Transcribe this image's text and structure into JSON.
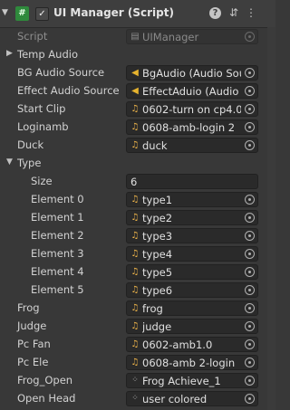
{
  "component": {
    "title": "UI Manager (Script)",
    "enabled": "✓",
    "script_icon": "#",
    "help": "?",
    "presets": "⇵",
    "menu": "⋮"
  },
  "fields": [
    {
      "label": "Script",
      "value": "UIManager",
      "icon": "script-icon",
      "dim": true
    },
    {
      "label": "Temp Audio",
      "foldout": "collapsed"
    },
    {
      "label": "BG Audio Source",
      "value": "BgAudio (Audio Sou",
      "icon": "audio-source-icon"
    },
    {
      "label": "Effect Audio Source",
      "value": "EffectAduio (Audio S",
      "icon": "audio-source-icon"
    },
    {
      "label": "Start Clip",
      "value": "0602-turn on cp4.0",
      "icon": "audio-clip-icon"
    },
    {
      "label": "Loginamb",
      "value": "0608-amb-login 2",
      "icon": "audio-clip-icon"
    },
    {
      "label": "Duck",
      "value": "duck",
      "icon": "audio-clip-icon"
    },
    {
      "label": "Type",
      "foldout": "expanded"
    },
    {
      "label": "Size",
      "number": "6"
    },
    {
      "label": "Element 0",
      "value": "type1",
      "icon": "audio-clip-icon"
    },
    {
      "label": "Element 1",
      "value": "type2",
      "icon": "audio-clip-icon"
    },
    {
      "label": "Element 2",
      "value": "type3",
      "icon": "audio-clip-icon"
    },
    {
      "label": "Element 3",
      "value": "type4",
      "icon": "audio-clip-icon"
    },
    {
      "label": "Element 4",
      "value": "type5",
      "icon": "audio-clip-icon"
    },
    {
      "label": "Element 5",
      "value": "type6",
      "icon": "audio-clip-icon"
    },
    {
      "label": "Frog",
      "value": "frog",
      "icon": "audio-clip-icon"
    },
    {
      "label": "Judge",
      "value": "judge",
      "icon": "audio-clip-icon"
    },
    {
      "label": "Pc Fan",
      "value": "0602-amb1.0",
      "icon": "audio-clip-icon"
    },
    {
      "label": "Pc Ele",
      "value": "0608-amb 2-login",
      "icon": "audio-clip-icon"
    },
    {
      "label": "Frog_Open",
      "value": "Frog Achieve_1",
      "icon": "custom-asset-icon"
    },
    {
      "label": "Open Head",
      "value": "user colored",
      "icon": "custom-asset-icon"
    }
  ],
  "colors": {
    "background": "#383838",
    "field": "#2a2a2a",
    "clip_icon": "#f0b64a",
    "audio_source_icon": "#e6b32e",
    "script_icon_bg": "#2f8a3c"
  }
}
